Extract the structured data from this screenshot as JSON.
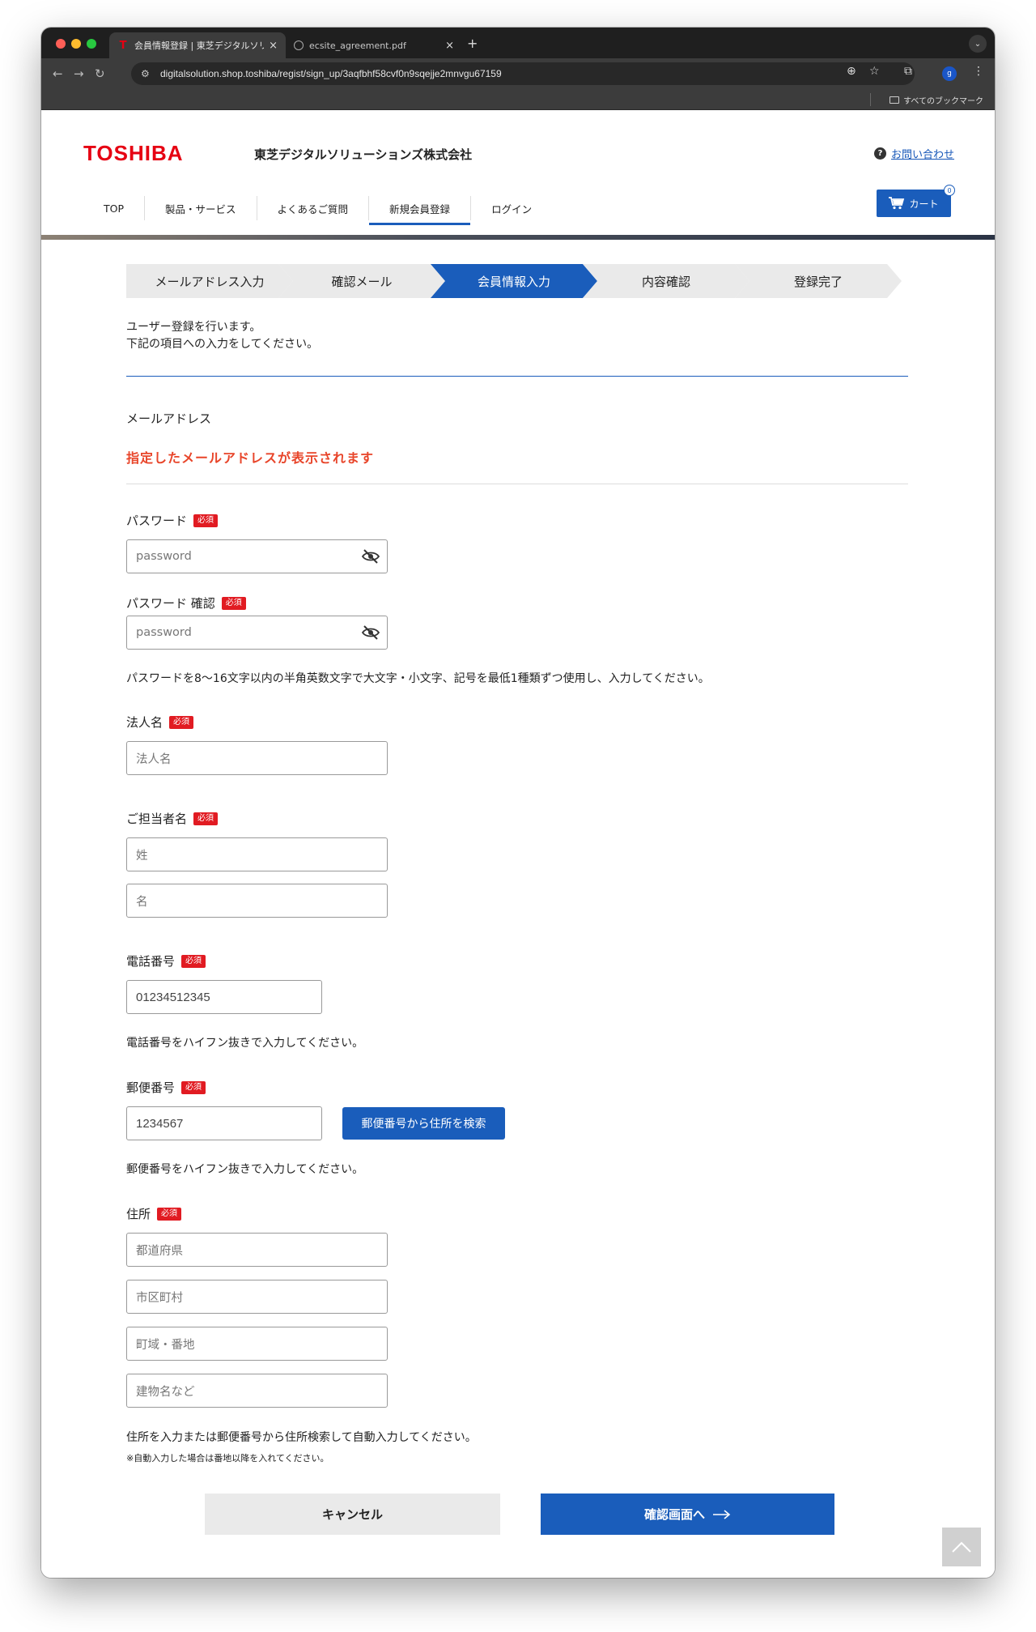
{
  "browser": {
    "tabs": [
      {
        "title": "会員情報登録 | 東芝デジタルソリ",
        "active": true,
        "favicon": "toshiba-t-icon"
      },
      {
        "title": "ecsite_agreement.pdf",
        "active": false,
        "favicon": "globe-icon"
      }
    ],
    "url": "digitalsolution.shop.toshiba/regist/sign_up/3aqfbhf58cvf0n9sqejje2mnvgu67159",
    "bookmarks_label": "すべてのブックマーク",
    "profile_initial": "g"
  },
  "header": {
    "logo": "TOSHIBA",
    "company": "東芝デジタルソリューションズ株式会社",
    "contact": "お問い合わせ",
    "nav": [
      "TOP",
      "製品・サービス",
      "よくあるご質問",
      "新規会員登録",
      "ログイン"
    ],
    "nav_active": "新規会員登録",
    "cart_label": "カート",
    "cart_count": "0",
    "accent_color": "#1a5dbb",
    "brand_color": "#e60012"
  },
  "stepper": [
    "メールアドレス入力",
    "確認メール",
    "会員情報入力",
    "内容確認",
    "登録完了"
  ],
  "stepper_active": "会員情報入力",
  "intro": {
    "line1": "ユーザー登録を行います。",
    "line2": "下記の項目への入力をしてください。"
  },
  "form": {
    "email_label": "メールアドレス",
    "email_note": "指定したメールアドレスが表示されます",
    "required": "必須",
    "password_label": "パスワード",
    "password_placeholder": "password",
    "password_confirm_label": "パスワード 確認",
    "password_confirm_placeholder": "password",
    "password_help": "パスワードを8〜16文字以内の半角英数文字で大文字・小文字、記号を最低1種類ずつ使用し、入力してください。",
    "company_label": "法人名",
    "company_placeholder": "法人名",
    "person_label": "ご担当者名",
    "last_name_placeholder": "姓",
    "first_name_placeholder": "名",
    "phone_label": "電話番号",
    "phone_value": "01234512345",
    "phone_help": "電話番号をハイフン抜きで入力してください。",
    "zip_label": "郵便番号",
    "zip_value": "1234567",
    "zip_button": "郵便番号から住所を検索",
    "zip_help": "郵便番号をハイフン抜きで入力してください。",
    "address_label": "住所",
    "pref_placeholder": "都道府県",
    "city_placeholder": "市区町村",
    "street_placeholder": "町域・番地",
    "building_placeholder": "建物名など",
    "address_help": "住所を入力または郵便番号から住所検索して自動入力してください。",
    "address_note": "※自動入力した場合は番地以降を入れてください。"
  },
  "actions": {
    "cancel": "キャンセル",
    "confirm": "確認画面へ"
  }
}
